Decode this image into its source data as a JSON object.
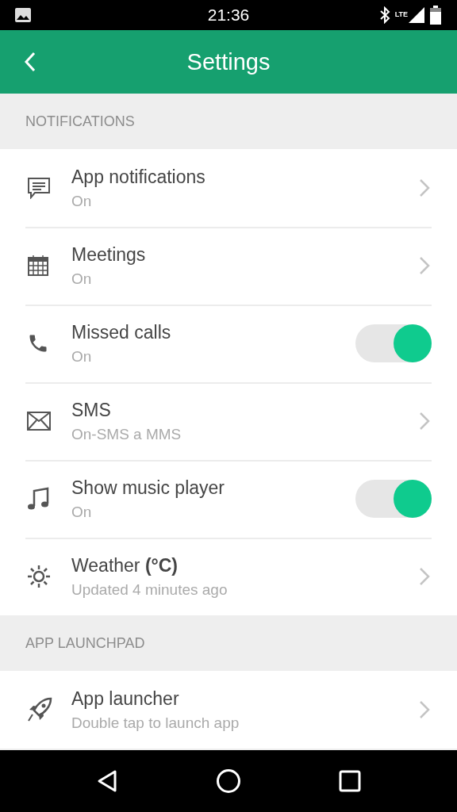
{
  "status_bar": {
    "time": "21:36",
    "network": "LTE"
  },
  "app_bar": {
    "title": "Settings"
  },
  "sections": [
    {
      "header": "NOTIFICATIONS",
      "items": [
        {
          "kind": "link",
          "title": "App notifications",
          "subtitle": "On"
        },
        {
          "kind": "link",
          "title": "Meetings",
          "subtitle": "On"
        },
        {
          "kind": "toggle",
          "title": "Missed calls",
          "subtitle": "On",
          "on": true
        },
        {
          "kind": "link",
          "title": "SMS",
          "subtitle": "On-SMS a MMS"
        },
        {
          "kind": "toggle",
          "title": "Show music player",
          "subtitle": "On",
          "on": true
        },
        {
          "kind": "link",
          "title": "Weather **(°C)**",
          "subtitle": "Updated 4 minutes ago"
        }
      ]
    },
    {
      "header": "APP LAUNCHPAD",
      "items": [
        {
          "kind": "link",
          "title": "App launcher",
          "subtitle": "Double tap to launch app"
        }
      ]
    }
  ]
}
